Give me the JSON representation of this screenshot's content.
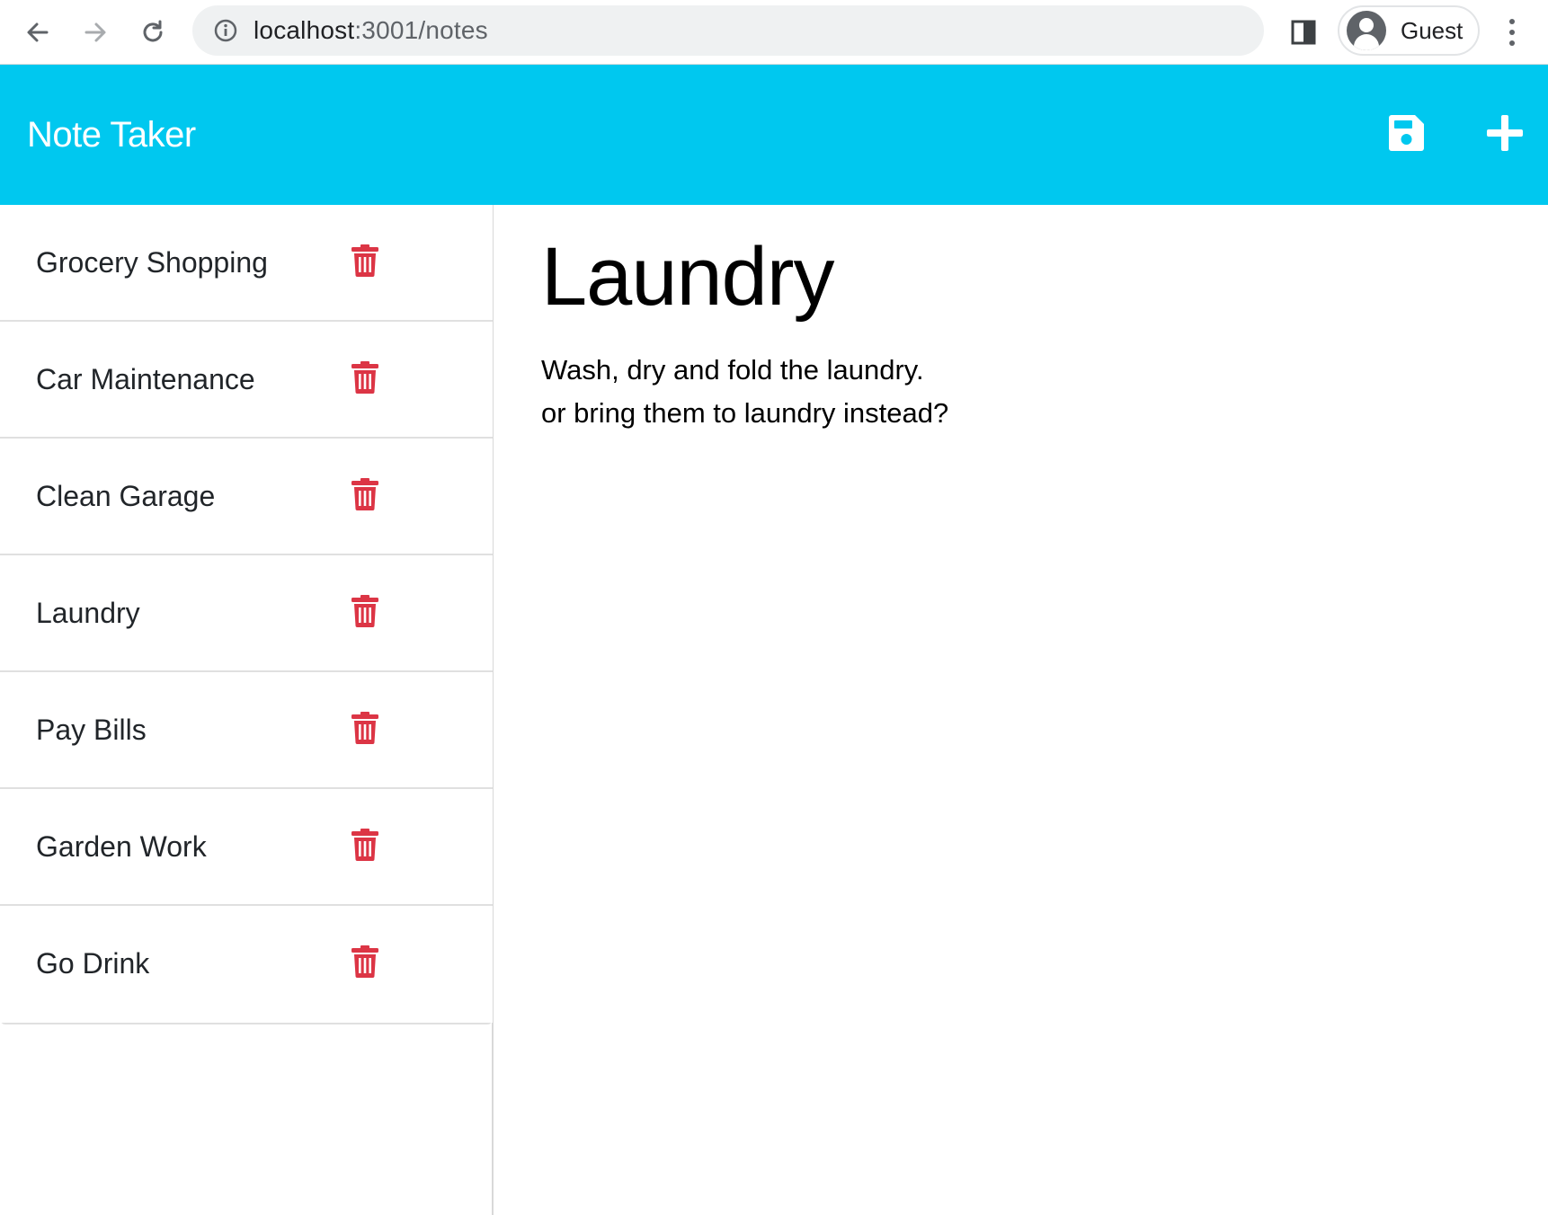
{
  "browser": {
    "url_host": "localhost",
    "url_rest": ":3001/notes",
    "profile_label": "Guest"
  },
  "app": {
    "title": "Note Taker",
    "header_color": "#00c8ef",
    "delete_color": "#dc3545",
    "icons": {
      "save": "floppy-disk-icon",
      "new_note": "plus-icon",
      "delete": "trash-icon"
    }
  },
  "notes": [
    {
      "title": "Grocery Shopping"
    },
    {
      "title": "Car Maintenance"
    },
    {
      "title": "Clean Garage"
    },
    {
      "title": "Laundry"
    },
    {
      "title": "Pay Bills"
    },
    {
      "title": "Garden Work"
    },
    {
      "title": "Go Drink"
    }
  ],
  "active_note": {
    "title": "Laundry",
    "text": "Wash, dry and fold the laundry.\nor bring them to laundry instead?"
  }
}
